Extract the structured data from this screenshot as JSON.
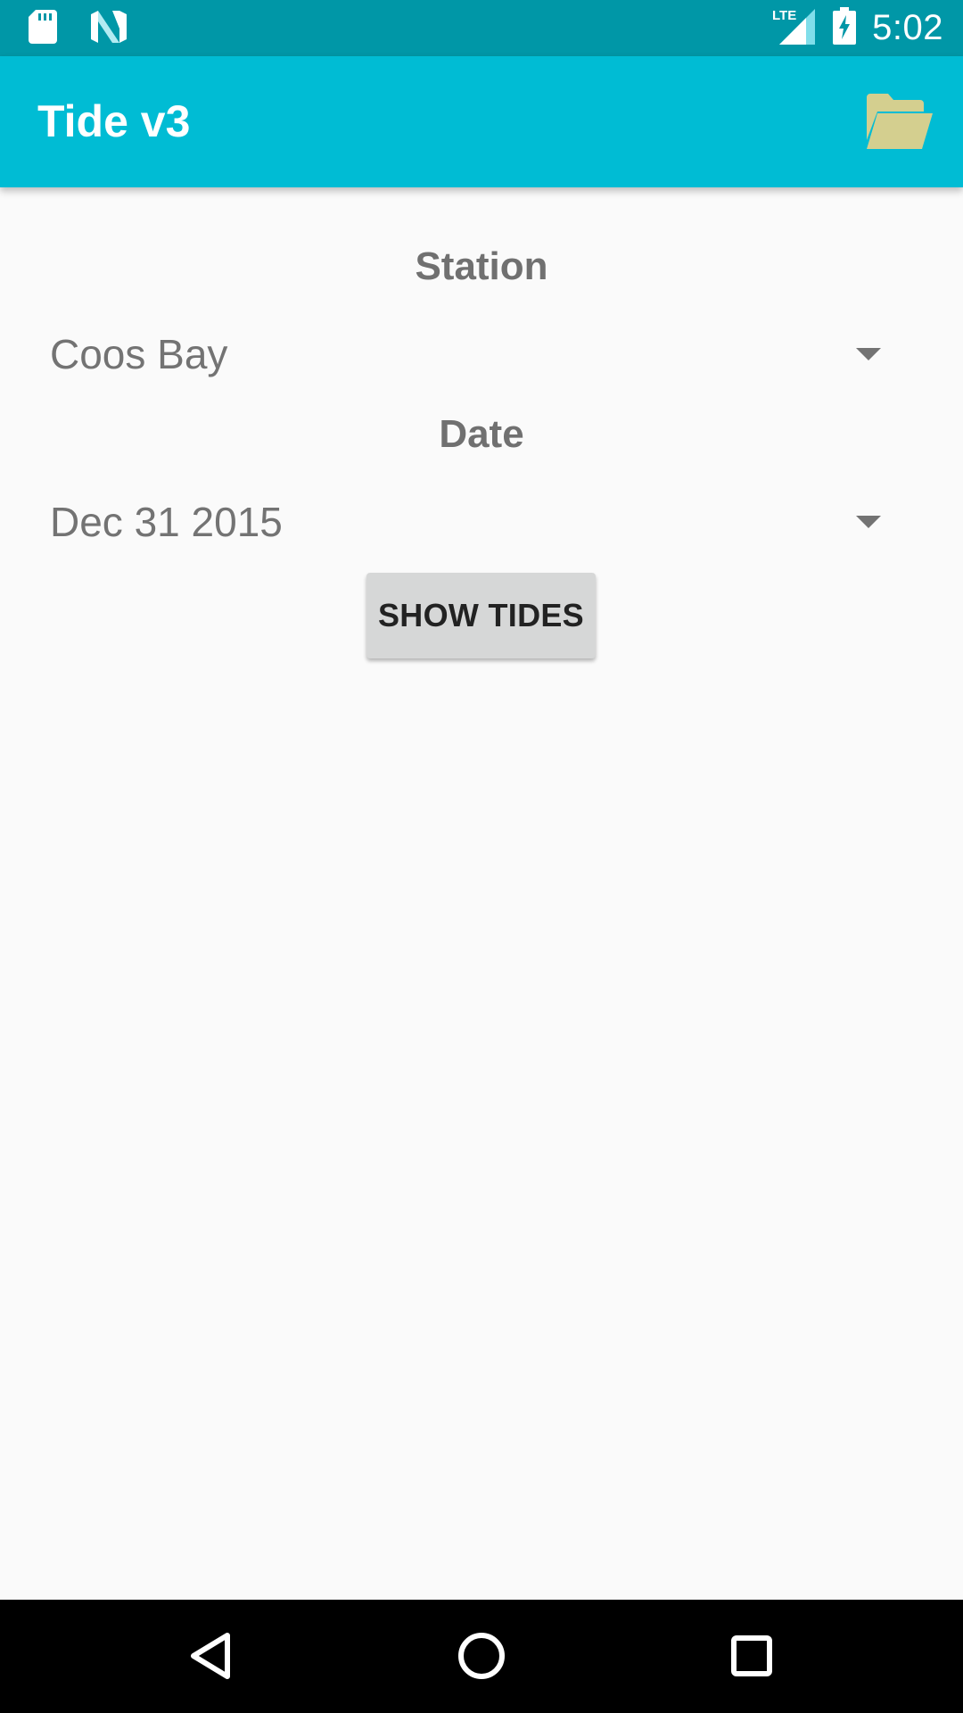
{
  "status_bar": {
    "time": "5:02",
    "network_label": "LTE",
    "icons": [
      "sd-card-icon",
      "n-logo-icon",
      "lte-signal-icon",
      "battery-charging-icon"
    ],
    "background_color": "#0097a7"
  },
  "app_bar": {
    "title": "Tide v3",
    "action_icon": "folder-open-icon",
    "background_color": "#00bcd4",
    "action_icon_color": "#d4cf8f"
  },
  "form": {
    "station_label": "Station",
    "station_value": "Coos Bay",
    "date_label": "Date",
    "date_value": "Dec 31 2015",
    "show_tides_label": "SHOW TIDES"
  },
  "nav_bar": {
    "icons": [
      "back-icon",
      "home-icon",
      "recents-icon"
    ]
  }
}
